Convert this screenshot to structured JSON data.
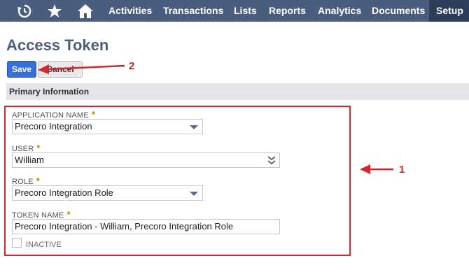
{
  "nav": {
    "items": [
      "Activities",
      "Transactions",
      "Lists",
      "Reports",
      "Analytics",
      "Documents",
      "Setup"
    ],
    "icons": [
      "recent-clock-icon",
      "star-icon",
      "home-icon"
    ]
  },
  "page": {
    "title": "Access Token"
  },
  "toolbar": {
    "save_label": "Save",
    "cancel_label": "Cancel"
  },
  "section": {
    "title": "Primary Information"
  },
  "form": {
    "application_name": {
      "label": "APPLICATION NAME",
      "value": "Precoro Integration"
    },
    "user": {
      "label": "USER",
      "value": "William"
    },
    "role": {
      "label": "ROLE",
      "value": "Precoro Integration Role"
    },
    "token_name": {
      "label": "TOKEN NAME",
      "value": "Precoro Integration - William, Precoro Integration Role"
    },
    "inactive": {
      "label": "INACTIVE",
      "checked": false
    },
    "required_mark": "*"
  },
  "annotations": {
    "one": "1",
    "two": "2",
    "color": "#d9232d"
  },
  "colors": {
    "nav_bg": "#4a5d7e",
    "nav_active": "#2f3e58",
    "save_bg": "#3b6fd8",
    "required": "#b98e00"
  }
}
